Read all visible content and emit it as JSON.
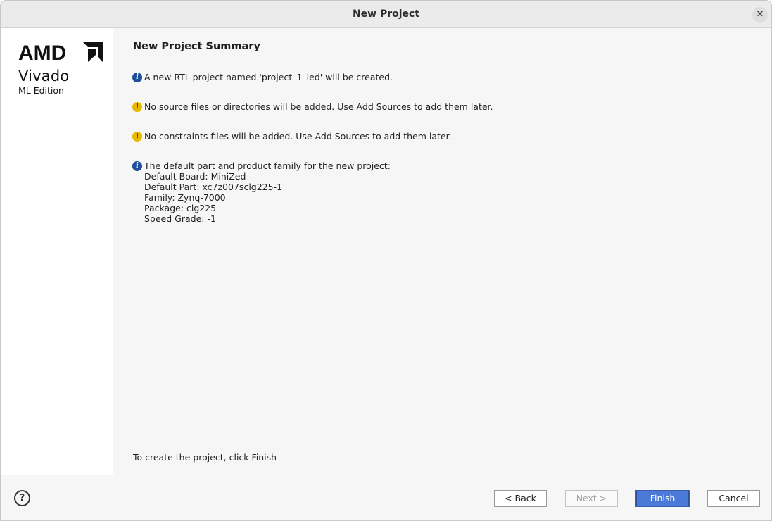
{
  "window": {
    "title": "New Project",
    "close_glyph": "✕"
  },
  "sidebar": {
    "logo_brand": "AMD",
    "product": "Vivado",
    "edition": "ML Edition"
  },
  "summary": {
    "heading": "New Project Summary",
    "messages": [
      {
        "icon": "info-icon",
        "text": "A new RTL project named 'project_1_led' will be created."
      },
      {
        "icon": "warning-icon",
        "text": "No source files or directories will be added. Use Add Sources to add them later."
      },
      {
        "icon": "warning-icon",
        "text": "No constraints files will be added. Use Add Sources to add them later."
      },
      {
        "icon": "info-icon",
        "text": "The default part and product family for the new project:"
      }
    ],
    "part_details": [
      "Default Board: MiniZed",
      "Default Part: xc7z007sclg225-1",
      "Family: Zynq-7000",
      "Package: clg225",
      "Speed Grade: -1"
    ],
    "footer": "To create the project, click Finish"
  },
  "buttons": {
    "help": "?",
    "back": "< Back",
    "next": "Next >",
    "finish": "Finish",
    "cancel": "Cancel"
  },
  "colors": {
    "info_icon": "#1f4e9b",
    "warning_icon": "#e6b800",
    "primary_button": "#4a79d8"
  }
}
